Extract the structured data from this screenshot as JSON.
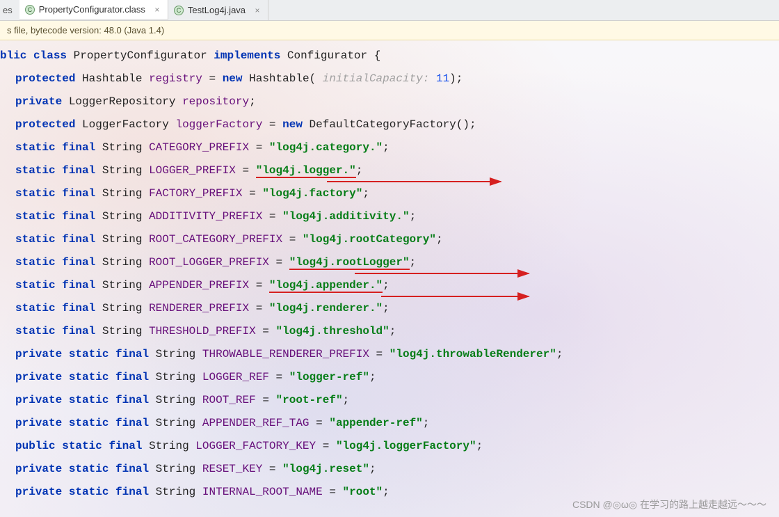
{
  "tabs": {
    "cut_left": "es",
    "items": [
      {
        "label": "PropertyConfigurator.class",
        "iconLetter": "C",
        "active": true
      },
      {
        "label": "TestLog4j.java",
        "iconLetter": "C",
        "active": false
      }
    ]
  },
  "infobar": "s file, bytecode version: 48.0 (Java 1.4)",
  "code": {
    "class_decl": {
      "kw_public": "blic",
      "kw_class": "class",
      "name": "PropertyConfigurator",
      "kw_implements": "implements",
      "iface": "Configurator"
    },
    "fields": [
      {
        "mods": [
          "protected"
        ],
        "type": "Hashtable",
        "name": "registry",
        "op": "= ",
        "rhs_kw": "new",
        "rhs_type": "Hashtable(",
        "hint_label": " initialCapacity: ",
        "hint_val": "11",
        "tail": ");"
      },
      {
        "mods": [
          "private"
        ],
        "type": "LoggerRepository",
        "name": "repository",
        "tail": ";"
      },
      {
        "mods": [
          "protected"
        ],
        "type": "LoggerFactory",
        "name": "loggerFactory",
        "op": "= ",
        "rhs_kw": "new",
        "rhs_type": "DefaultCategoryFactory()",
        "tail": ";"
      },
      {
        "mods": [
          "static",
          "final"
        ],
        "type": "String",
        "name": "CATEGORY_PREFIX",
        "op": "= ",
        "str": "\"log4j.category.\"",
        "tail": ";"
      },
      {
        "mods": [
          "static",
          "final"
        ],
        "type": "String",
        "name": "LOGGER_PREFIX",
        "op": "= ",
        "str": "\"log4j.logger.\"",
        "tail": ";",
        "annot": "underline"
      },
      {
        "mods": [
          "static",
          "final"
        ],
        "type": "String",
        "name": "FACTORY_PREFIX",
        "op": "= ",
        "str": "\"log4j.factory\"",
        "tail": ";"
      },
      {
        "mods": [
          "static",
          "final"
        ],
        "type": "String",
        "name": "ADDITIVITY_PREFIX",
        "op": "= ",
        "str": "\"log4j.additivity.\"",
        "tail": ";"
      },
      {
        "mods": [
          "static",
          "final"
        ],
        "type": "String",
        "name": "ROOT_CATEGORY_PREFIX",
        "op": "= ",
        "str": "\"log4j.rootCategory\"",
        "tail": ";"
      },
      {
        "mods": [
          "static",
          "final"
        ],
        "type": "String",
        "name": "ROOT_LOGGER_PREFIX",
        "op": "= ",
        "str": "\"log4j.rootLogger\"",
        "tail": ";",
        "annot": "underline"
      },
      {
        "mods": [
          "static",
          "final"
        ],
        "type": "String",
        "name": "APPENDER_PREFIX",
        "op": "= ",
        "str": "\"log4j.appender.\"",
        "tail": ";",
        "annot": "underline"
      },
      {
        "mods": [
          "static",
          "final"
        ],
        "type": "String",
        "name": "RENDERER_PREFIX",
        "op": "= ",
        "str": "\"log4j.renderer.\"",
        "tail": ";"
      },
      {
        "mods": [
          "static",
          "final"
        ],
        "type": "String",
        "name": "THRESHOLD_PREFIX",
        "op": "= ",
        "str": "\"log4j.threshold\"",
        "tail": ";"
      },
      {
        "mods": [
          "private",
          "static",
          "final"
        ],
        "type": "String",
        "name": "THROWABLE_RENDERER_PREFIX",
        "op": "= ",
        "str": "\"log4j.throwableRenderer\"",
        "tail": ";"
      },
      {
        "mods": [
          "private",
          "static",
          "final"
        ],
        "type": "String",
        "name": "LOGGER_REF",
        "op": "= ",
        "str": "\"logger-ref\"",
        "tail": ";"
      },
      {
        "mods": [
          "private",
          "static",
          "final"
        ],
        "type": "String",
        "name": "ROOT_REF",
        "op": "= ",
        "str": "\"root-ref\"",
        "tail": ";"
      },
      {
        "mods": [
          "private",
          "static",
          "final"
        ],
        "type": "String",
        "name": "APPENDER_REF_TAG",
        "op": "= ",
        "str": "\"appender-ref\"",
        "tail": ";"
      },
      {
        "mods": [
          "public",
          "static",
          "final"
        ],
        "type": "String",
        "name": "LOGGER_FACTORY_KEY",
        "op": "= ",
        "str": "\"log4j.loggerFactory\"",
        "tail": ";"
      },
      {
        "mods": [
          "private",
          "static",
          "final"
        ],
        "type": "String",
        "name": "RESET_KEY",
        "op": "= ",
        "str": "\"log4j.reset\"",
        "tail": ";"
      },
      {
        "mods": [
          "private",
          "static",
          "final"
        ],
        "type": "String",
        "name": "INTERNAL_ROOT_NAME",
        "op": "= ",
        "str": "\"root\"",
        "tail": ";"
      }
    ]
  },
  "watermark": "CSDN @◎ω◎ 在学习的路上越走越远～～～"
}
